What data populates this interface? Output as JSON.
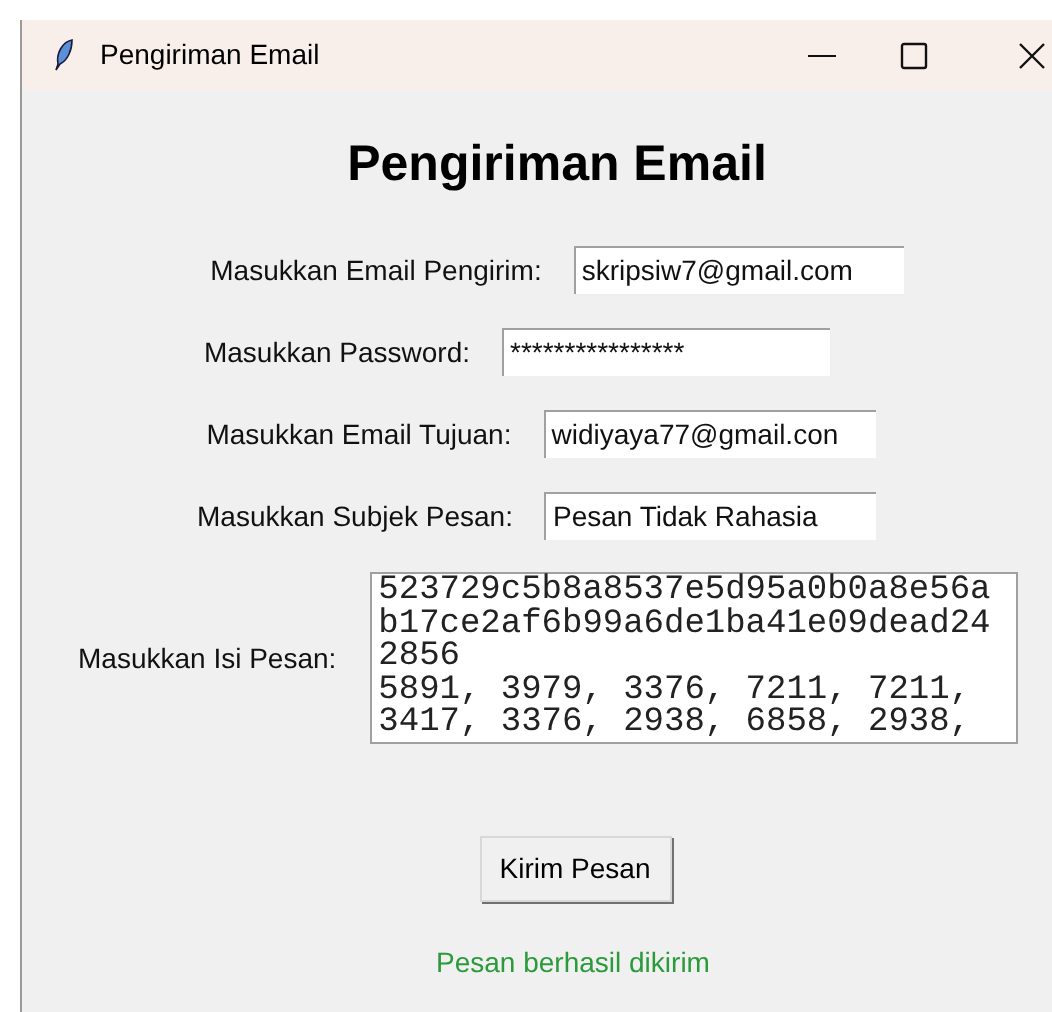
{
  "window": {
    "title": "Pengiriman Email"
  },
  "heading": "Pengiriman Email",
  "fields": [
    {
      "label": "Masukkan Email Pengirim:",
      "value": "skripsiw7@gmail.com"
    },
    {
      "label": "Masukkan Password:",
      "value": "****************"
    },
    {
      "label": "Masukkan Email Tujuan:",
      "value": "widiyaya77@gmail.con"
    },
    {
      "label": "Masukkan Subjek Pesan:",
      "value": "Pesan Tidak Rahasia"
    }
  ],
  "message": {
    "label": "Masukkan Isi Pesan:",
    "lines": [
      "523729c5b8a8537e5d95a0b0a8e56a",
      "b17ce2af6b99a6de1ba41e09dead24",
      "2856",
      "5891, 3979, 3376, 7211, 7211,",
      "3417, 3376, 2938, 6858, 2938,"
    ]
  },
  "button": "Kirim Pesan",
  "status": "Pesan berhasil dikirim"
}
